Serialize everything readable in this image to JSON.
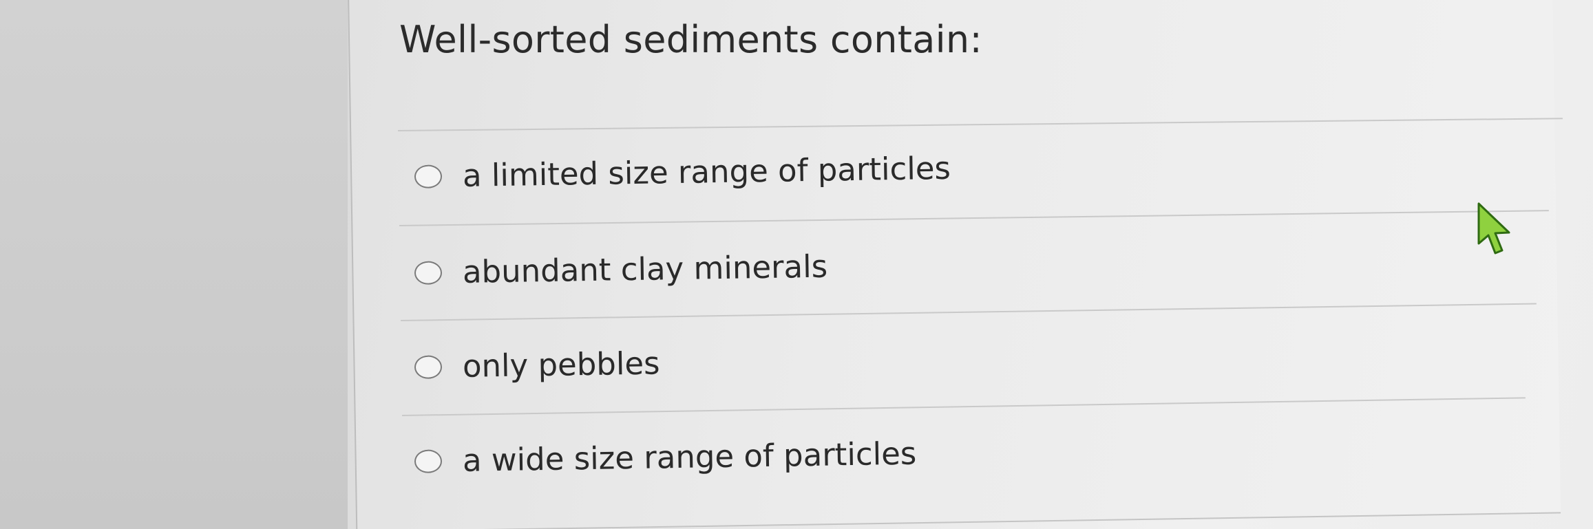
{
  "question": {
    "text": "Well-sorted sediments contain:"
  },
  "options": [
    {
      "label": "a limited size range of particles",
      "selected": false
    },
    {
      "label": "abundant clay minerals",
      "selected": false
    },
    {
      "label": "only pebbles",
      "selected": false
    },
    {
      "label": "a wide size range of particles",
      "selected": false
    }
  ],
  "icons": {
    "cursor": "mouse-pointer-arrow"
  },
  "colors": {
    "cursor_fill": "#8fd13f",
    "cursor_stroke": "#2f6b12",
    "text": "#2b2b2b",
    "radio_border": "#7a7a7a"
  }
}
